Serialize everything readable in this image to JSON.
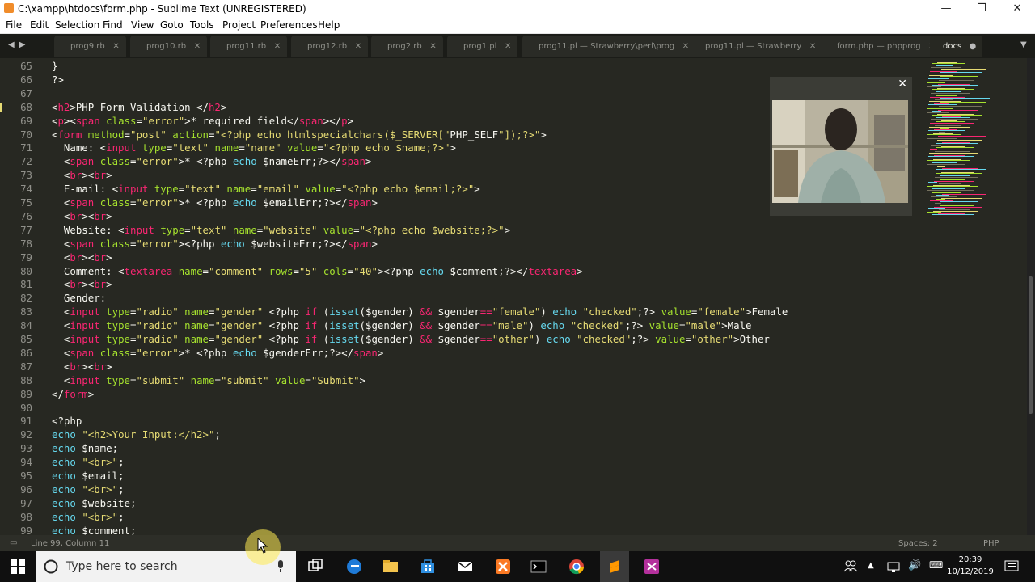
{
  "window": {
    "title": "C:\\xampp\\htdocs\\form.php - Sublime Text (UNREGISTERED)"
  },
  "menu": [
    "File",
    "Edit",
    "Selection",
    "Find",
    "View",
    "Goto",
    "Tools",
    "Project",
    "Preferences",
    "Help"
  ],
  "tabs": [
    {
      "label": "prog9.rb",
      "active": false
    },
    {
      "label": "prog10.rb",
      "active": false
    },
    {
      "label": "prog11.rb",
      "active": false
    },
    {
      "label": "prog12.rb",
      "active": false
    },
    {
      "label": "prog2.rb",
      "active": false
    },
    {
      "label": "prog1.pl",
      "active": false
    },
    {
      "label": "prog11.pl — Strawberry\\perl\\prog",
      "active": false
    },
    {
      "label": "prog11.pl — Strawberry",
      "active": false
    },
    {
      "label": "form.php — phpprog",
      "active": false
    },
    {
      "label": "docs",
      "active": true
    }
  ],
  "editor": {
    "lines": [
      {
        "n": "65",
        "t": "}"
      },
      {
        "n": "66",
        "t": "?>"
      },
      {
        "n": "67",
        "t": ""
      },
      {
        "n": "68",
        "t": "<h2>PHP Form Validation </h2>"
      },
      {
        "n": "69",
        "t": "<p><span class=\"error\">* required field</span></p>"
      },
      {
        "n": "70",
        "t": "<form method=\"post\" action=\"<?php echo htmlspecialchars($_SERVER[\"PHP_SELF\"]);?>\">"
      },
      {
        "n": "71",
        "t": "  Name: <input type=\"text\" name=\"name\" value=\"<?php echo $name;?>\">"
      },
      {
        "n": "72",
        "t": "  <span class=\"error\">* <?php echo $nameErr;?></span>"
      },
      {
        "n": "73",
        "t": "  <br><br>"
      },
      {
        "n": "74",
        "t": "  E-mail: <input type=\"text\" name=\"email\" value=\"<?php echo $email;?>\">"
      },
      {
        "n": "75",
        "t": "  <span class=\"error\">* <?php echo $emailErr;?></span>"
      },
      {
        "n": "76",
        "t": "  <br><br>"
      },
      {
        "n": "77",
        "t": "  Website: <input type=\"text\" name=\"website\" value=\"<?php echo $website;?>\">"
      },
      {
        "n": "78",
        "t": "  <span class=\"error\"><?php echo $websiteErr;?></span>"
      },
      {
        "n": "79",
        "t": "  <br><br>"
      },
      {
        "n": "80",
        "t": "  Comment: <textarea name=\"comment\" rows=\"5\" cols=\"40\"><?php echo $comment;?></textarea>"
      },
      {
        "n": "81",
        "t": "  <br><br>"
      },
      {
        "n": "82",
        "t": "  Gender:"
      },
      {
        "n": "83",
        "t": "  <input type=\"radio\" name=\"gender\" <?php if (isset($gender) && $gender==\"female\") echo \"checked\";?> value=\"female\">Female"
      },
      {
        "n": "84",
        "t": "  <input type=\"radio\" name=\"gender\" <?php if (isset($gender) && $gender==\"male\") echo \"checked\";?> value=\"male\">Male"
      },
      {
        "n": "85",
        "t": "  <input type=\"radio\" name=\"gender\" <?php if (isset($gender) && $gender==\"other\") echo \"checked\";?> value=\"other\">Other"
      },
      {
        "n": "86",
        "t": "  <span class=\"error\">* <?php echo $genderErr;?></span>"
      },
      {
        "n": "87",
        "t": "  <br><br>"
      },
      {
        "n": "88",
        "t": "  <input type=\"submit\" name=\"submit\" value=\"Submit\">"
      },
      {
        "n": "89",
        "t": "</form>"
      },
      {
        "n": "90",
        "t": ""
      },
      {
        "n": "91",
        "t": "<?php"
      },
      {
        "n": "92",
        "t": "echo \"<h2>Your Input:</h2>\";"
      },
      {
        "n": "93",
        "t": "echo $name;"
      },
      {
        "n": "94",
        "t": "echo \"<br>\";"
      },
      {
        "n": "95",
        "t": "echo $email;"
      },
      {
        "n": "96",
        "t": "echo \"<br>\";"
      },
      {
        "n": "97",
        "t": "echo $website;"
      },
      {
        "n": "98",
        "t": "echo \"<br>\";"
      },
      {
        "n": "99",
        "t": "echo $comment;"
      }
    ]
  },
  "status": {
    "position": "Line 99, Column 11",
    "spaces": "Spaces: 2",
    "syntax": "PHP"
  },
  "taskbar": {
    "search_placeholder": "Type here to search",
    "time": "20:39",
    "date": "10/12/2019"
  },
  "colors": {
    "bg": "#272822",
    "tag": "#f92672",
    "attr": "#a6e22e",
    "string": "#e6db74",
    "keyword": "#66d9ef"
  }
}
